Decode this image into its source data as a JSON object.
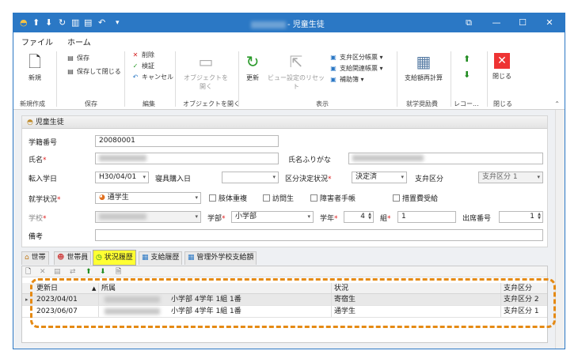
{
  "window": {
    "title": "- 児童生徒",
    "quick_access": [
      {
        "icon": "app-logo-icon",
        "glyph": "◓"
      },
      {
        "icon": "upload-icon",
        "glyph": "⬆"
      },
      {
        "icon": "download-icon",
        "glyph": "⬇"
      },
      {
        "icon": "refresh-icon",
        "glyph": "↻"
      },
      {
        "icon": "columns-icon",
        "glyph": "▥"
      },
      {
        "icon": "save-icon",
        "glyph": "▤"
      },
      {
        "icon": "back-arrow-icon",
        "glyph": "↶"
      },
      {
        "icon": "dropdown-icon",
        "glyph": "▾"
      }
    ],
    "controls": {
      "restore": "⧉",
      "minimize": "—",
      "maximize": "☐",
      "close": "✕"
    }
  },
  "menu": {
    "file": "ファイル",
    "home": "ホーム"
  },
  "ribbon": {
    "new_label": "新規",
    "save_label": "保存",
    "save_close_label": "保存して閉じる",
    "delete_label": "削除",
    "verify_label": "検証",
    "cancel_label": "キャンセル",
    "open_object_label": "オブジェクトを開く",
    "refresh_label": "更新",
    "reset_view_label": "ビュー設定のリセット",
    "payment_class_label": "支弁区分帳票",
    "payment_related_label": "支給関連帳票",
    "subledger_label": "補助簿",
    "recalc_label": "支給額再計算",
    "close_label": "閉じる",
    "groups": {
      "new": "新規作成",
      "save": "保存",
      "edit": "編集",
      "open_object": "オブジェクトを開く",
      "display": "表示",
      "school_aid": "就学奨励費",
      "record": "レコー...",
      "close": "閉じる"
    }
  },
  "panel": {
    "title": "児童生徒"
  },
  "form": {
    "student_no_label": "学籍番号",
    "student_no": "20080001",
    "name_label": "氏名",
    "kana_label": "氏名ふりがな",
    "transfer_label": "転入学日",
    "transfer_date": "H30/04/01",
    "bedding_label": "寝具購入日",
    "bedding_date": "",
    "decision_label": "区分決定状況",
    "decision_value": "決定済",
    "payment_class_label": "支弁区分",
    "payment_class_value": "支弁区分 1",
    "status_label": "就学状況",
    "status_value": "通学生",
    "check_labels": [
      "肢体重複",
      "訪問生",
      "障害者手帳",
      "措置費受給"
    ],
    "school_label": "学校",
    "dept_label": "学部",
    "dept_value": "小学部",
    "grade_label": "学年",
    "grade_value": "4",
    "class_label": "組",
    "class_value": "1",
    "attendance_label": "出席番号",
    "attendance_value": "1",
    "remarks_label": "備考",
    "required_mark": "*"
  },
  "tabs": [
    "世帯",
    "世帯員",
    "状況履歴",
    "支給履歴",
    "管理外学校支給額"
  ],
  "grid": {
    "toolbar_icons": [
      "new-row-icon",
      "delete-row-icon",
      "save-grid-icon",
      "link-icon",
      "up-icon",
      "down-icon",
      "export-icon"
    ],
    "columns": [
      "更新日",
      "所属",
      "状況",
      "支弁区分"
    ],
    "sort_indicator": "▲",
    "rows": [
      {
        "date": "2023/04/01",
        "affiliation": "小学部 4学年 1組 1番",
        "status": "寄宿生",
        "payment": "支弁区分 2"
      },
      {
        "date": "2023/06/07",
        "affiliation": "小学部 4学年 1組 1番",
        "status": "通学生",
        "payment": "支弁区分 1"
      }
    ]
  }
}
